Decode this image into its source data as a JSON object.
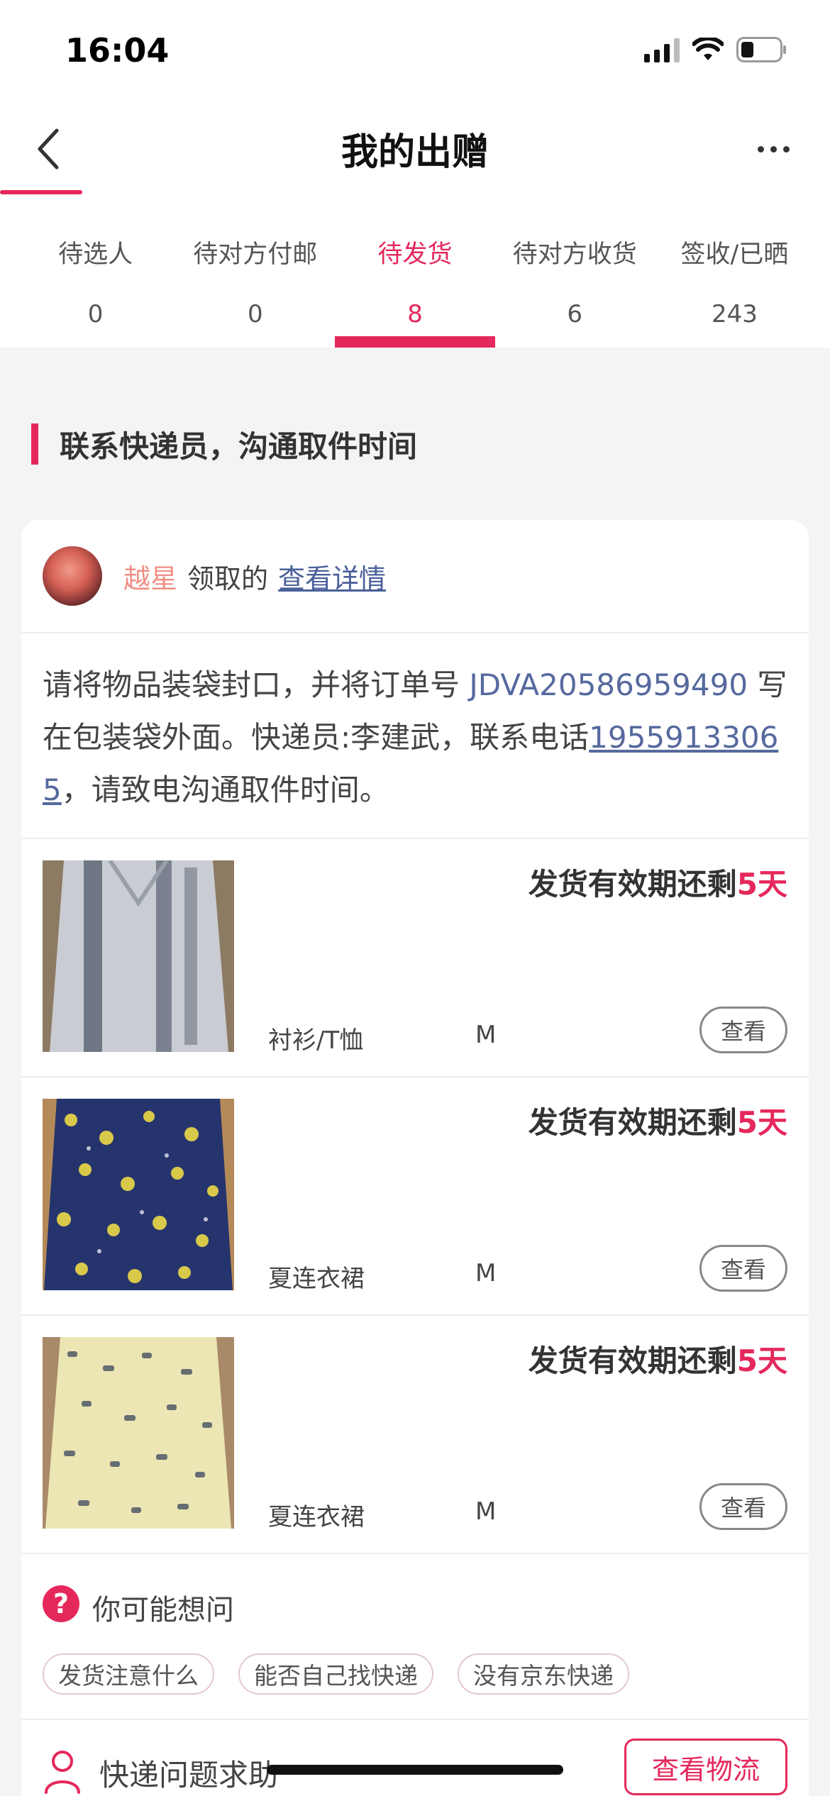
{
  "status_bar": {
    "time": "16:04"
  },
  "nav": {
    "title": "我的出赠"
  },
  "tabs": [
    {
      "label": "待选人",
      "count": "0",
      "active": false
    },
    {
      "label": "待对方付邮",
      "count": "0",
      "active": false
    },
    {
      "label": "待发货",
      "count": "8",
      "active": true
    },
    {
      "label": "待对方收货",
      "count": "6",
      "active": false
    },
    {
      "label": "签收/已晒",
      "count": "243",
      "active": false
    }
  ],
  "section": {
    "title": "联系快递员，沟通取件时间"
  },
  "card": {
    "receiver_name": "越星",
    "receiver_suffix": "领取的",
    "detail_link": "查看详情",
    "instructions": {
      "part1": "请将物品装袋封口，并将订单号 ",
      "order_no": "JDVA20586959490",
      "part2": " 写在包装袋外面。快递员:李建武，联系电话",
      "phone": "19559133065",
      "part3": "，请致电沟通取件时间。"
    },
    "items": [
      {
        "deadline_prefix": "发货有效期还剩",
        "days": "5天",
        "category": "衬衫/T恤",
        "size": "M",
        "view_label": "查看"
      },
      {
        "deadline_prefix": "发货有效期还剩",
        "days": "5天",
        "category": "夏连衣裙",
        "size": "M",
        "view_label": "查看"
      },
      {
        "deadline_prefix": "发货有效期还剩",
        "days": "5天",
        "category": "夏连衣裙",
        "size": "M",
        "view_label": "查看"
      }
    ],
    "faq": {
      "title": "你可能想问",
      "chips": [
        "发货注意什么",
        "能否自己找快递",
        "没有京东快递"
      ]
    },
    "help": {
      "text": "快递问题求助",
      "logistics_button": "查看物流"
    }
  },
  "colors": {
    "accent": "#e5285b",
    "link": "#56699e",
    "receiver": "#ef8f86"
  },
  "icons": [
    "back-icon",
    "more-icon",
    "signal-icon",
    "wifi-icon",
    "battery-icon",
    "question-icon",
    "person-icon"
  ]
}
